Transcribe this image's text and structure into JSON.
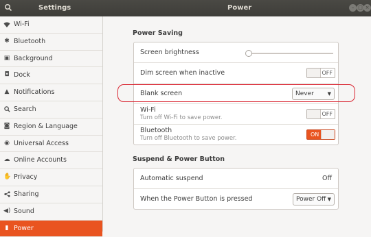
{
  "window": {
    "sidebar_title": "Settings",
    "panel_title": "Power",
    "controls": [
      "minimize-icon",
      "maximize-icon",
      "close-icon"
    ]
  },
  "sidebar": {
    "items": [
      {
        "label": "Wi-Fi",
        "icon": "wifi-icon",
        "selected": false
      },
      {
        "label": "Bluetooth",
        "icon": "bluetooth-icon",
        "selected": false
      },
      {
        "label": "Background",
        "icon": "background-icon",
        "selected": false
      },
      {
        "label": "Dock",
        "icon": "dock-icon",
        "selected": false
      },
      {
        "label": "Notifications",
        "icon": "bell-icon",
        "selected": false
      },
      {
        "label": "Search",
        "icon": "search-icon",
        "selected": false
      },
      {
        "label": "Region & Language",
        "icon": "camera-icon",
        "selected": false
      },
      {
        "label": "Universal Access",
        "icon": "accessibility-icon",
        "selected": false
      },
      {
        "label": "Online Accounts",
        "icon": "cloud-icon",
        "selected": false
      },
      {
        "label": "Privacy",
        "icon": "hand-icon",
        "selected": false
      },
      {
        "label": "Sharing",
        "icon": "share-icon",
        "selected": false
      },
      {
        "label": "Sound",
        "icon": "speaker-icon",
        "selected": false
      },
      {
        "label": "Power",
        "icon": "battery-icon",
        "selected": true
      }
    ]
  },
  "power_saving": {
    "title": "Power Saving",
    "screen_brightness": {
      "label": "Screen brightness",
      "level": 0.0
    },
    "dim_screen": {
      "label": "Dim screen when inactive",
      "state": "OFF"
    },
    "blank_screen": {
      "label": "Blank screen",
      "value": "Never"
    },
    "wifi": {
      "label": "Wi-Fi",
      "description": "Turn off Wi-Fi to save power.",
      "state": "OFF"
    },
    "bluetooth": {
      "label": "Bluetooth",
      "description": "Turn off Bluetooth to save power.",
      "state": "ON"
    }
  },
  "suspend": {
    "title": "Suspend & Power Button",
    "automatic_suspend": {
      "label": "Automatic suspend",
      "value": "Off"
    },
    "power_button": {
      "label": "When the Power Button is pressed",
      "value": "Power Off"
    }
  },
  "colors": {
    "accent": "#e95420",
    "highlight": "#d9232f",
    "titlebar": "#3e3d39"
  }
}
